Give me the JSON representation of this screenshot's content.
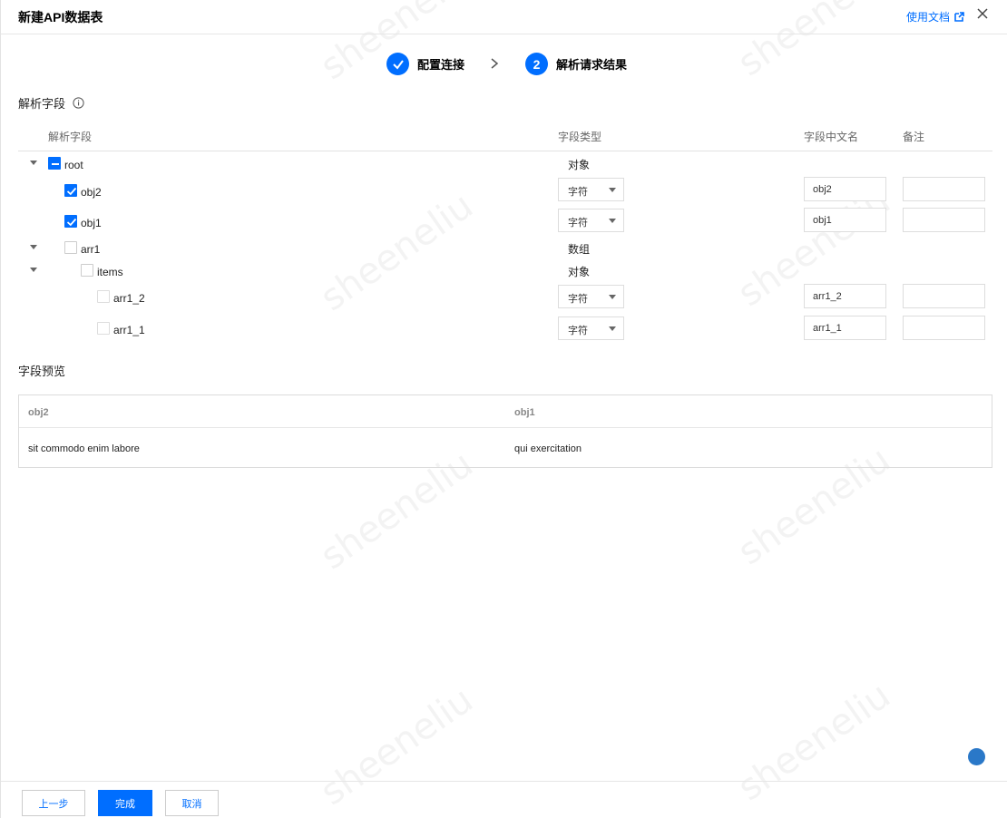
{
  "header": {
    "title": "新建API数据表",
    "doc_link": "使用文档"
  },
  "steps": [
    {
      "index": "1",
      "label": "配置连接",
      "done": true
    },
    {
      "index": "2",
      "label": "解析请求结果",
      "done": false
    }
  ],
  "parse_section": {
    "title": "解析字段",
    "columns": {
      "field": "解析字段",
      "type": "字段类型",
      "cn_name": "字段中文名",
      "remark": "备注"
    },
    "rows": [
      {
        "name": "root",
        "check": "partial",
        "type_text": "对象"
      },
      {
        "name": "obj2",
        "check": "checked",
        "type_select": "字符",
        "cn_name": "obj2",
        "remark": ""
      },
      {
        "name": "obj1",
        "check": "checked",
        "type_select": "字符",
        "cn_name": "obj1",
        "remark": ""
      },
      {
        "name": "arr1",
        "check": "unchecked",
        "type_text": "数组"
      },
      {
        "name": "items",
        "check": "unchecked",
        "type_text": "对象"
      },
      {
        "name": "arr1_2",
        "check": "disabled",
        "type_select": "字符",
        "cn_name": "arr1_2",
        "remark": ""
      },
      {
        "name": "arr1_1",
        "check": "disabled",
        "type_select": "字符",
        "cn_name": "arr1_1",
        "remark": ""
      }
    ]
  },
  "preview_section": {
    "title": "字段预览",
    "headers": [
      "obj2",
      "obj1"
    ],
    "rows": [
      [
        "sit commodo enim labore",
        "qui exercitation"
      ]
    ]
  },
  "footer": {
    "prev": "上一步",
    "finish": "完成",
    "cancel": "取消"
  },
  "watermark": "sheeneliu",
  "colors": {
    "primary": "#006eff",
    "fab": "#2a78c8"
  }
}
